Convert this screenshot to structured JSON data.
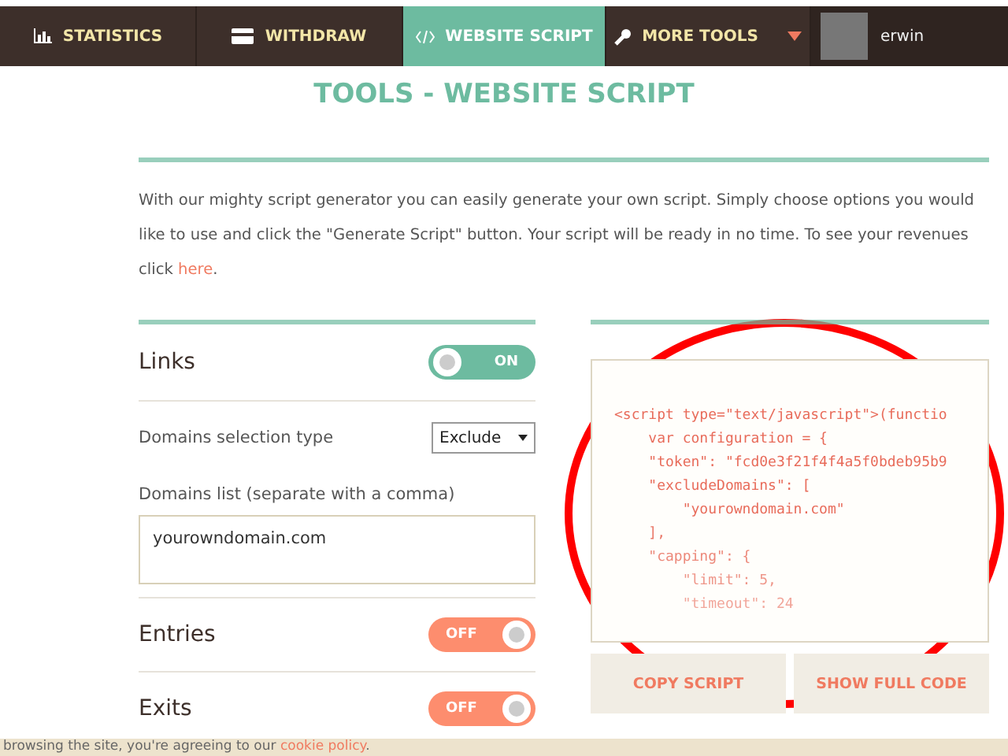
{
  "nav": {
    "items": [
      {
        "label": "STATISTICS",
        "selected": false
      },
      {
        "label": "WITHDRAW",
        "selected": false
      },
      {
        "label": "WEBSITE SCRIPT",
        "selected": true
      },
      {
        "label": "MORE TOOLS",
        "selected": false,
        "dropdown": true
      }
    ],
    "user": {
      "name": "erwin"
    }
  },
  "title": "TOOLS - WEBSITE SCRIPT",
  "intro": {
    "text": "With our mighty script generator you can easily generate your own script. Simply choose options you would like to use and click the \"Generate Script\" button. Your script will be ready in no time. To see your revenues click ",
    "link": "here",
    "end": "."
  },
  "options": [
    {
      "kind": "toggle",
      "label": "Links",
      "switch": {
        "on": true,
        "label": "ON"
      }
    },
    {
      "kind": "select",
      "label": "Domains selection type",
      "value": "Exclude"
    },
    {
      "kind": "textarea",
      "label": "Domains list (separate with a comma)",
      "value": "yourowndomain.com"
    },
    {
      "kind": "toggle",
      "label": "Entries",
      "switch": {
        "on": false,
        "label": "OFF"
      }
    },
    {
      "kind": "toggle",
      "label": "Exits",
      "switch": {
        "on": false,
        "label": "OFF"
      }
    }
  ],
  "code": {
    "lines": [
      "<script type=\"text/javascript\">(functio",
      "    var configuration = {",
      "    \"token\": \"fcd0e3f21f4f4a5f0bdeb95b9",
      "    \"excludeDomains\": [",
      "        \"yourowndomain.com\"",
      "    ],",
      "    \"capping\": {",
      "        \"limit\": 5,",
      "        \"timeout\": 24"
    ]
  },
  "buttons": [
    "COPY SCRIPT",
    "SHOW FULL CODE"
  ],
  "cookie": {
    "text": "browsing the site, you're agreeing to our ",
    "link": "cookie policy",
    "end": "."
  }
}
